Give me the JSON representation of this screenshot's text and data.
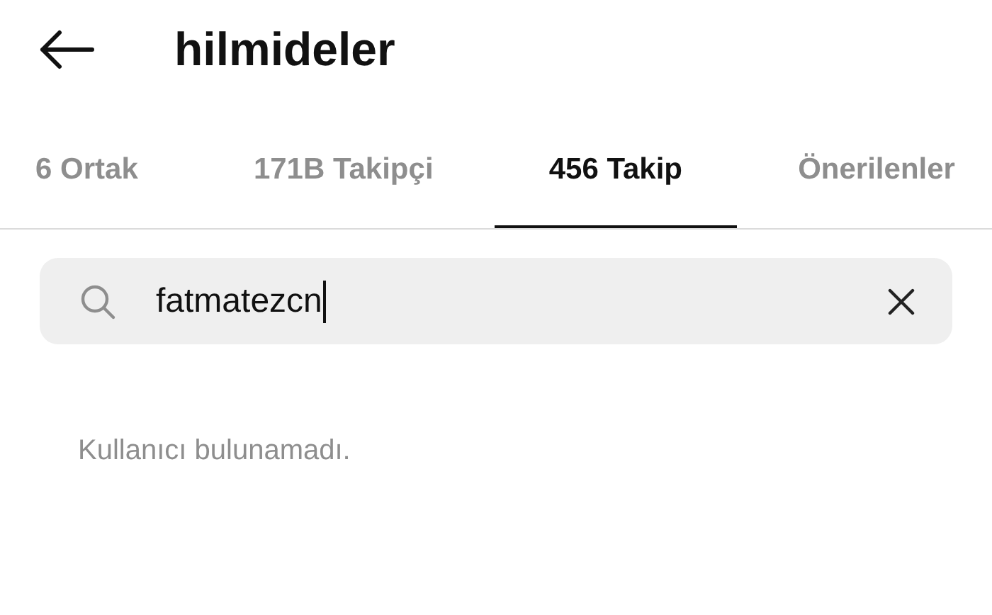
{
  "header": {
    "title": "hilmideler"
  },
  "tabs": [
    {
      "label": "6 Ortak",
      "selected": false
    },
    {
      "label": "171B Takipçi",
      "selected": false
    },
    {
      "label": "456 Takip",
      "selected": true
    },
    {
      "label": "Önerilenler",
      "selected": false
    }
  ],
  "search": {
    "value": "fatmatezcn"
  },
  "message": "Kullanıcı bulunamadı."
}
